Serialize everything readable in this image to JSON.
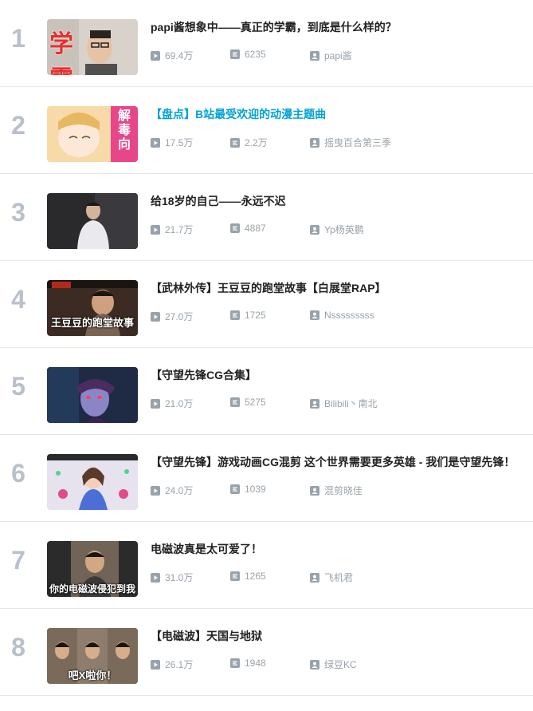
{
  "ranking": [
    {
      "rank": "1",
      "title": "papi酱想象中——真正的学霸，到底是什么样的？",
      "plays": "69.4万",
      "danmaku": "6235",
      "uploader": "papi酱",
      "highlight": false,
      "thumb_text": "学霸"
    },
    {
      "rank": "2",
      "title": "【盘点】B站最受欢迎的动漫主题曲",
      "plays": "17.5万",
      "danmaku": "2.2万",
      "uploader": "摇曳百合第三季",
      "highlight": true,
      "thumb_text": "解毒向"
    },
    {
      "rank": "3",
      "title": "给18岁的自己——永远不迟",
      "plays": "21.7万",
      "danmaku": "4887",
      "uploader": "Yp杨英鹏",
      "highlight": false,
      "thumb_text": ""
    },
    {
      "rank": "4",
      "title": "【武林外传】王豆豆的跑堂故事【白展堂RAP】",
      "plays": "27.0万",
      "danmaku": "1725",
      "uploader": "Nsssssssss",
      "highlight": false,
      "thumb_text": "王豆豆的跑堂故事"
    },
    {
      "rank": "5",
      "title": "【守望先锋CG合集】",
      "plays": "21.0万",
      "danmaku": "5275",
      "uploader": "Bilibili丶南北",
      "highlight": false,
      "thumb_text": ""
    },
    {
      "rank": "6",
      "title": "【守望先锋】游戏动画CG混剪 这个世界需要更多英雄 - 我们是守望先锋！",
      "plays": "24.0万",
      "danmaku": "1039",
      "uploader": "混剪晓佳",
      "highlight": false,
      "thumb_text": ""
    },
    {
      "rank": "7",
      "title": "电磁波真是太可爱了！",
      "plays": "31.0万",
      "danmaku": "1265",
      "uploader": "飞机君",
      "highlight": false,
      "thumb_text": "你的电磁波侵犯到我"
    },
    {
      "rank": "8",
      "title": "【电磁波】天国与地狱",
      "plays": "26.1万",
      "danmaku": "1948",
      "uploader": "绿豆KC",
      "highlight": false,
      "thumb_text": "吧X啦你！"
    }
  ],
  "colors": {
    "highlight": "#00a1d6",
    "rank": "#b8c0cc",
    "meta": "#99a2aa",
    "divider": "#e5e9ef"
  },
  "icons": {
    "plays": "play-icon",
    "danmaku": "danmaku-icon",
    "uploader": "uploader-icon"
  }
}
